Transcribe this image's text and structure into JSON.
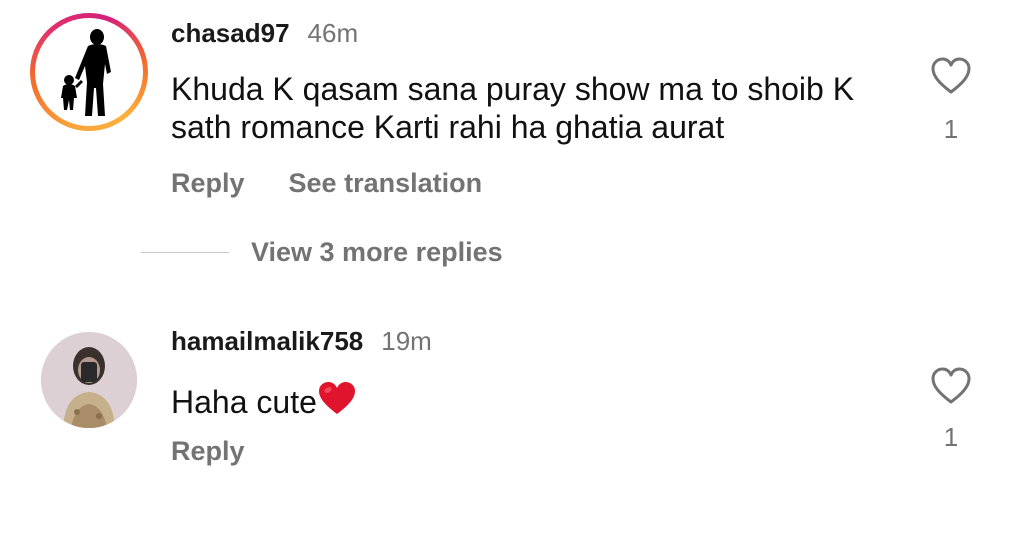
{
  "comments": [
    {
      "username": "chasad97",
      "timestamp": "46m",
      "text": "Khuda K qasam sana puray show ma to shoib K sath romance Karti rahi ha ghatia aurat",
      "text_suffix": "",
      "actions": {
        "reply": "Reply",
        "translate": "See translation"
      },
      "likes": "1",
      "avatar": {
        "has_story_ring": true,
        "icon": "parent-child-silhouette"
      }
    },
    {
      "username": "hamailmalik758",
      "timestamp": "19m",
      "text": "Haha cute",
      "text_suffix": "heart-emoji",
      "actions": {
        "reply": "Reply"
      },
      "likes": "1",
      "avatar": {
        "has_story_ring": false,
        "icon": "user-photo"
      }
    }
  ],
  "view_replies_label": "View 3 more replies",
  "colors": {
    "text": "#111111",
    "secondary": "#737373",
    "heart_emoji": "#e0142c",
    "story_ring": [
      "#f9a23a",
      "#e1306c",
      "#d21f7a"
    ]
  }
}
